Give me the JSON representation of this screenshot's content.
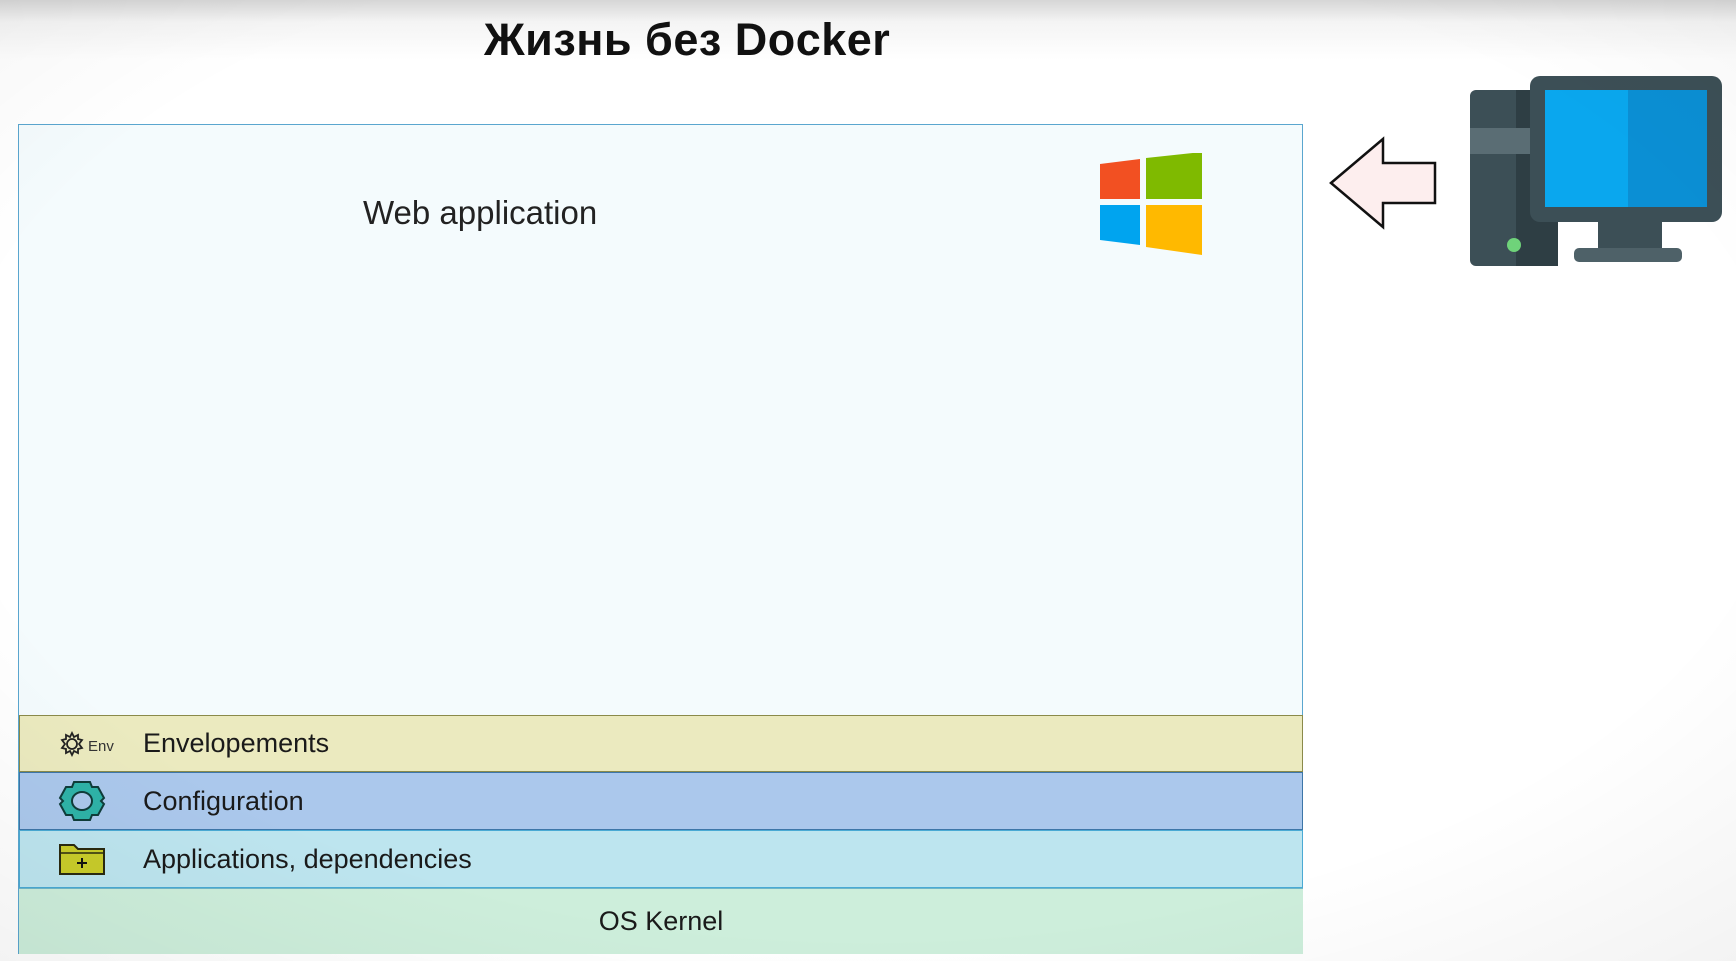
{
  "title": "Жизнь без Docker",
  "stack": {
    "app_label": "Web application",
    "layers": {
      "env": {
        "label": "Envelopements",
        "icon_text": "Env"
      },
      "config": {
        "label": "Configuration"
      },
      "apps": {
        "label": "Applications, dependencies"
      },
      "os": {
        "label": "OS Kernel"
      }
    }
  },
  "colors": {
    "env_layer": "#ebeabf",
    "config_layer": "#abc8ec",
    "apps_layer": "#bde5ef",
    "os_layer": "#cdeedb",
    "stack_border": "#5aa6cf",
    "win_red": "#f25022",
    "win_green": "#7fba00",
    "win_blue": "#00a4ef",
    "win_yellow": "#ffb900",
    "monitor_screen": "#0aa7ee",
    "pc_body": "#3c4f56"
  },
  "icons": [
    "windows-logo-icon",
    "arrow-left-icon",
    "desktop-computer-icon",
    "gear-env-icon",
    "gear-icon",
    "folder-plus-icon"
  ]
}
